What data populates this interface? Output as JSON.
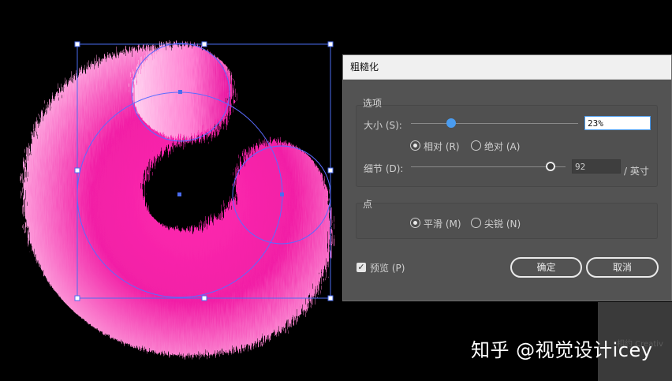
{
  "dialog": {
    "title": "粗糙化",
    "options_group": "选项",
    "size_label": "大小 (S):",
    "size_value": "23%",
    "relative_label": "相对 (R)",
    "absolute_label": "绝对 (A)",
    "detail_label": "细节 (D):",
    "detail_value": "92",
    "detail_unit": "/ 英寸",
    "point_group": "点",
    "smooth_label": "平滑 (M)",
    "sharp_label": "尖锐 (N)",
    "preview_label": "预览 (P)",
    "ok_label": "确定",
    "cancel_label": "取消",
    "size_slider_fraction": 0.23,
    "detail_slider_fraction": 0.92
  },
  "panel": {
    "faint_text": "相约 Creativ"
  },
  "watermark": "知乎 @视觉设计icey",
  "colors": {
    "fur_pink": "#f21fa6",
    "fur_light": "#ffb8e6",
    "selection_blue": "#4a6cf0",
    "slider_blue": "#4a9cf0",
    "dialog_bg": "#535353"
  }
}
